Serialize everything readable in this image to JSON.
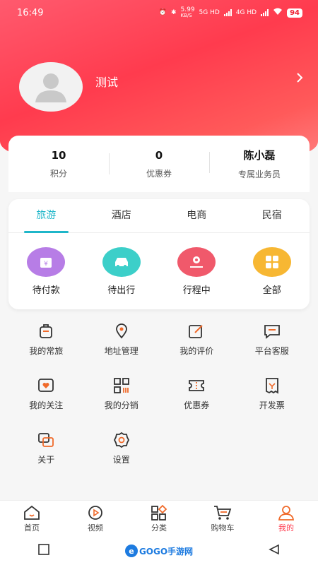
{
  "status_bar": {
    "time": "16:49",
    "net_speed_top": "5.99",
    "net_speed_bottom": "KB/S",
    "signal1": "5G HD",
    "signal2": "4G HD",
    "battery": "94"
  },
  "profile": {
    "username": "测试"
  },
  "stats": [
    {
      "value": "10",
      "label": "积分"
    },
    {
      "value": "0",
      "label": "优惠券"
    },
    {
      "value": "陈小磊",
      "label": "专属业务员"
    }
  ],
  "order_tabs": [
    "旅游",
    "酒店",
    "电商",
    "民宿"
  ],
  "active_tab": "旅游",
  "orders": [
    {
      "label": "待付款",
      "icon": "wallet-icon",
      "color": "#b77de6"
    },
    {
      "label": "待出行",
      "icon": "car-icon",
      "color": "#3ccfc9"
    },
    {
      "label": "行程中",
      "icon": "route-icon",
      "color": "#f0596b"
    },
    {
      "label": "全部",
      "icon": "grid-icon",
      "color": "#f7b733"
    }
  ],
  "services": [
    {
      "label": "我的常旅",
      "icon": "luggage-icon"
    },
    {
      "label": "地址管理",
      "icon": "location-icon"
    },
    {
      "label": "我的评价",
      "icon": "edit-icon"
    },
    {
      "label": "平台客服",
      "icon": "chat-icon"
    },
    {
      "label": "我的关注",
      "icon": "heart-icon"
    },
    {
      "label": "我的分销",
      "icon": "qrcode-icon"
    },
    {
      "label": "优惠券",
      "icon": "ticket-icon"
    },
    {
      "label": "开发票",
      "icon": "receipt-icon"
    },
    {
      "label": "关于",
      "icon": "about-icon"
    },
    {
      "label": "设置",
      "icon": "gear-icon"
    }
  ],
  "tabbar": [
    {
      "label": "首页",
      "icon": "home-icon"
    },
    {
      "label": "视频",
      "icon": "play-icon"
    },
    {
      "label": "分类",
      "icon": "category-icon"
    },
    {
      "label": "购物车",
      "icon": "cart-icon"
    },
    {
      "label": "我的",
      "icon": "user-icon"
    }
  ],
  "active_tabbar": "我的",
  "watermark": {
    "text": "GOGO手游网"
  },
  "colors": {
    "brand_red": "#ff3b4e",
    "accent_cyan": "#1fb6c9",
    "icon_orange": "#f06a2a"
  }
}
